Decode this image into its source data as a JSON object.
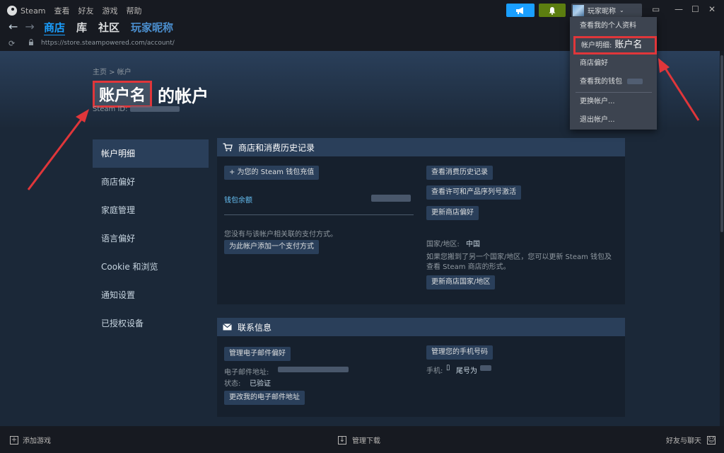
{
  "topbar": {
    "menu": [
      "Steam",
      "查看",
      "好友",
      "游戏",
      "帮助"
    ],
    "user_name": "玩家昵称",
    "window_controls": [
      "▭",
      "—",
      "☐",
      "✕"
    ]
  },
  "nav": {
    "tabs": [
      "商店",
      "库",
      "社区",
      "玩家昵称"
    ]
  },
  "url": "https://store.steampowered.com/account/",
  "breadcrumb": "主页 > 帐户",
  "title": {
    "name": "账户名",
    "suffix": "的帐户"
  },
  "steam_id_label": "Steam ID:",
  "sidebar": {
    "items": [
      "帐户明细",
      "商店偏好",
      "家庭管理",
      "语言偏好",
      "Cookie 和浏览",
      "通知设置",
      "已授权设备"
    ]
  },
  "store_panel": {
    "header": "商店和消费历史记录",
    "add_funds": "+ 为您的 Steam 钱包充值",
    "wallet_balance": "钱包余额",
    "no_payment": "您没有与该帐户相关联的支付方式。",
    "add_payment": "为此帐户添加一个支付方式",
    "view_history": "查看消费历史记录",
    "view_licenses": "查看许可和产品序列号激活",
    "update_prefs": "更新商店偏好",
    "country_label": "国家/地区:",
    "country_value": "中国",
    "country_note": "如果您搬到了另一个国家/地区，您可以更新 Steam 钱包及查看 Steam 商店的形式。",
    "update_country": "更新商店国家/地区"
  },
  "contact_panel": {
    "header": "联系信息",
    "manage_email_prefs": "管理电子邮件偏好",
    "email_label": "电子邮件地址:",
    "status_label": "状态:",
    "status_value": "已验证",
    "change_email": "更改我的电子邮件地址",
    "manage_phone": "管理您的手机号码",
    "phone_label": "手机:",
    "phone_value": "尾号为"
  },
  "dropdown": {
    "items": [
      "查看我的个人资料",
      "帐户明细:",
      "商店偏好",
      "查看我的钱包",
      "更换帐户...",
      "退出帐户..."
    ],
    "account_name": "账户名"
  },
  "bottombar": {
    "add_game": "添加游戏",
    "manage_downloads": "管理下载",
    "friends_chat": "好友与聊天"
  },
  "colors": {
    "accent": "#1a9fff",
    "highlight": "#e0363a",
    "link": "#66c0f4"
  }
}
